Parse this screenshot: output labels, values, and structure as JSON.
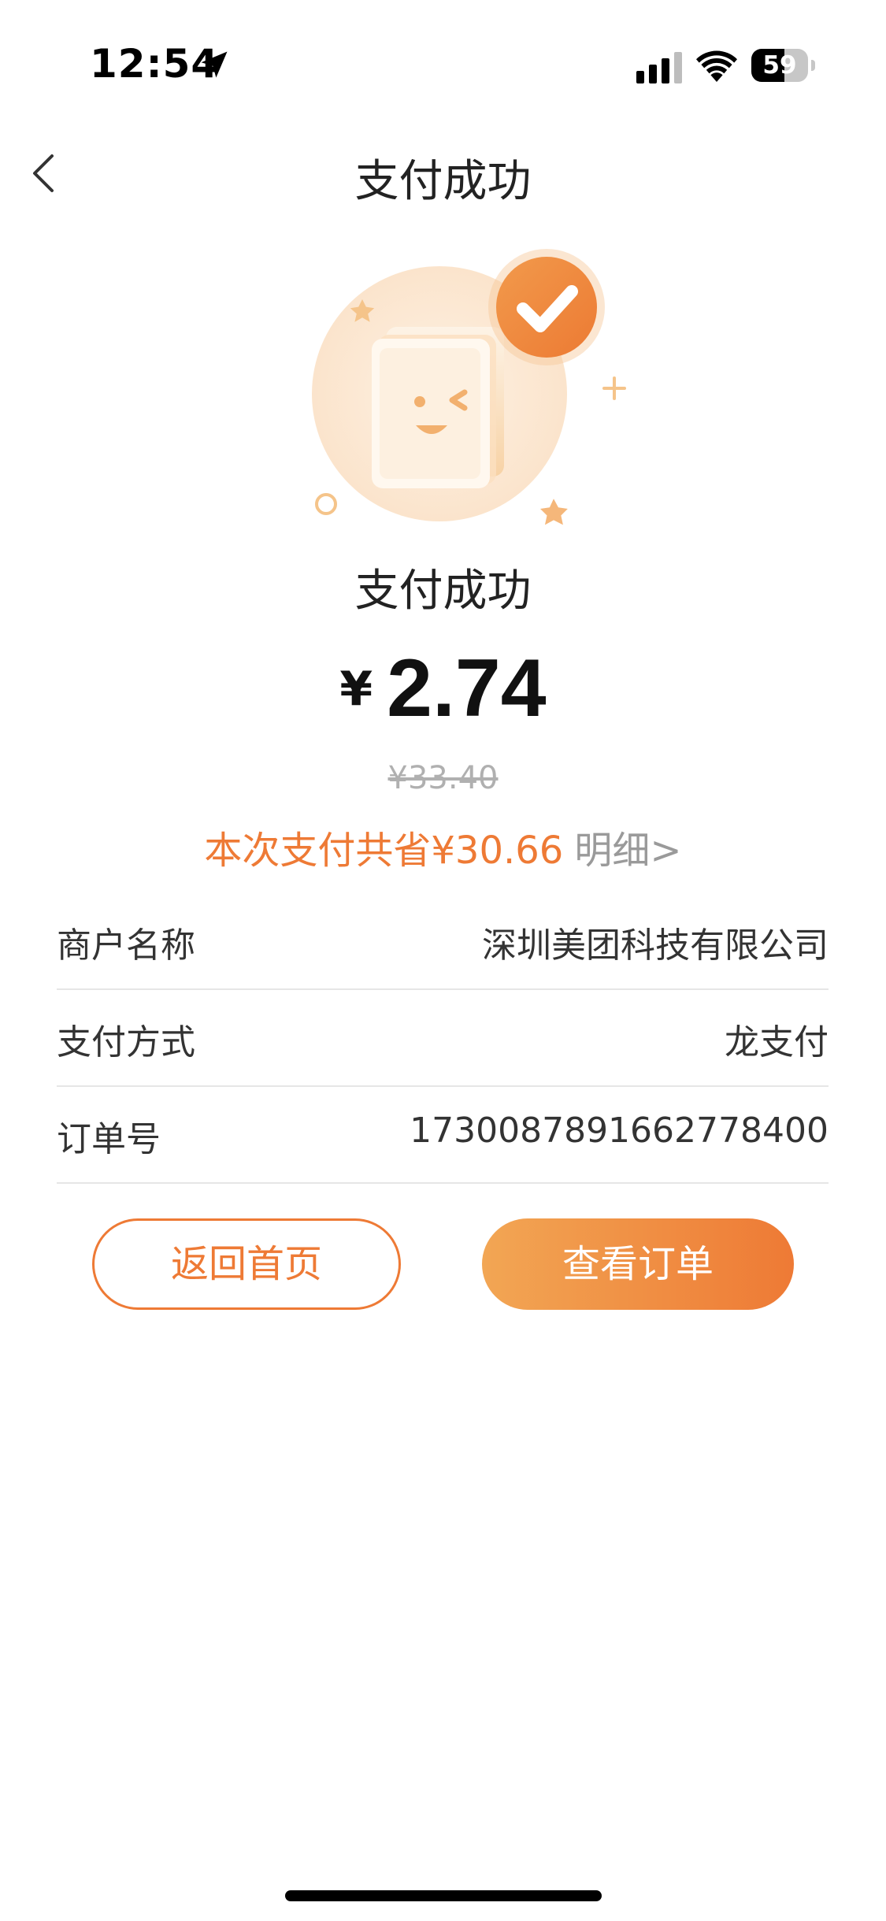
{
  "status_bar": {
    "time": "12:54",
    "battery_level": "59",
    "battery_fraction": 0.59,
    "icons": [
      "location-arrow-icon",
      "signal-icon",
      "wifi-icon",
      "battery-icon"
    ]
  },
  "nav": {
    "back_icon": "chevron-left-icon",
    "title": "支付成功"
  },
  "result": {
    "illustration_icon": "payment-success-illustration",
    "check_icon": "checkmark-icon",
    "title": "支付成功",
    "currency_symbol": "¥",
    "amount": "2.74",
    "original_price": "¥33.40",
    "savings_text": "本次支付共省¥30.66",
    "detail_link": "明细>"
  },
  "info": {
    "rows": [
      {
        "label": "商户名称",
        "value": "深圳美团科技有限公司"
      },
      {
        "label": "支付方式",
        "value": "龙支付"
      },
      {
        "label": "订单号",
        "value": "1730087891662778400"
      }
    ]
  },
  "actions": {
    "home_button": "返回首页",
    "order_button": "查看订单"
  },
  "colors": {
    "accent": "#ee7a35",
    "accent_light": "#f2a654",
    "muted_text": "#9a9a9a",
    "divider": "#e6e6e6"
  }
}
